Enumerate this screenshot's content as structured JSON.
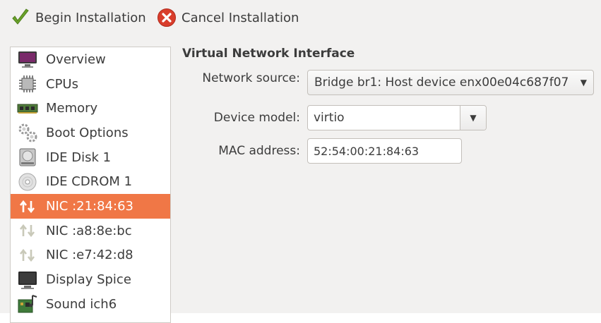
{
  "toolbar": {
    "begin_label": "Begin Installation",
    "begin_icon": "checkmark-icon",
    "cancel_label": "Cancel Installation",
    "cancel_icon": "cancel-icon",
    "check_color": "#6aa22a",
    "cancel_color": "#d93d2b"
  },
  "sidebar": {
    "selected_color": "#f07746",
    "items": [
      {
        "label": "Overview",
        "icon": "monitor-icon"
      },
      {
        "label": "CPUs",
        "icon": "cpu-icon"
      },
      {
        "label": "Memory",
        "icon": "memory-icon"
      },
      {
        "label": "Boot Options",
        "icon": "gears-icon"
      },
      {
        "label": "IDE Disk 1",
        "icon": "disk-icon"
      },
      {
        "label": "IDE CDROM 1",
        "icon": "cdrom-icon"
      },
      {
        "label": "NIC :21:84:63",
        "icon": "network-icon",
        "selected": true
      },
      {
        "label": "NIC :a8:8e:bc",
        "icon": "network-icon"
      },
      {
        "label": "NIC :e7:42:d8",
        "icon": "network-icon"
      },
      {
        "label": "Display Spice",
        "icon": "display-icon"
      },
      {
        "label": "Sound ich6",
        "icon": "sound-icon"
      }
    ]
  },
  "main": {
    "section_title": "Virtual Network Interface",
    "network_source_label": "Network source:",
    "network_source_value": "Bridge br1: Host device enx00e04c687f07",
    "device_model_label": "Device model:",
    "device_model_value": "virtio",
    "mac_label": "MAC address:",
    "mac_value": "52:54:00:21:84:63"
  }
}
